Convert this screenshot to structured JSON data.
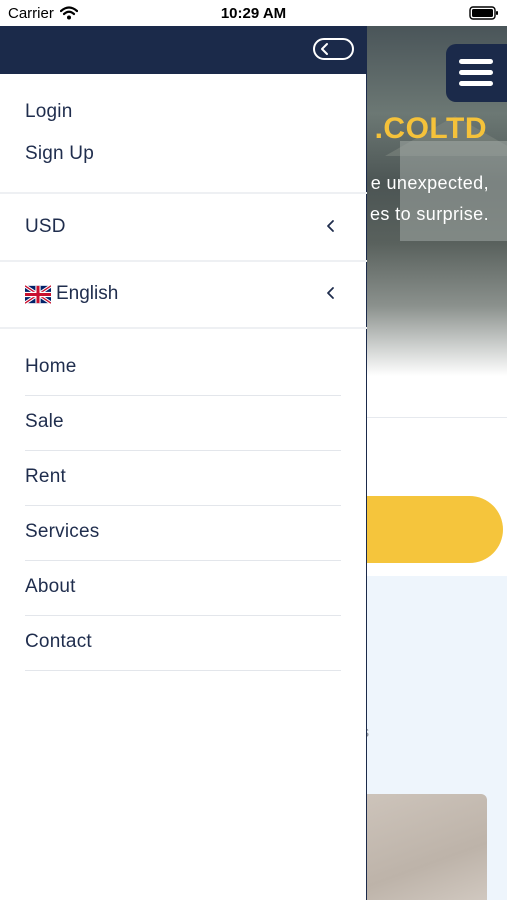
{
  "status_bar": {
    "carrier": "Carrier",
    "time": "10:29 AM"
  },
  "background": {
    "hero_title": ".COLTD",
    "hero_line1": "e unexpected,",
    "hero_line2": "es to surprise.",
    "properties_text": "erties",
    "colors": {
      "accent_yellow": "#f5c23a",
      "navy": "#1b2a4a",
      "light_blue": "#eef5fc"
    }
  },
  "drawer": {
    "auth": {
      "login": "Login",
      "signup": "Sign Up"
    },
    "currency": {
      "value": "USD"
    },
    "language": {
      "value": "English",
      "flag_icon": "uk-flag-icon"
    },
    "nav": [
      "Home",
      "Sale",
      "Rent",
      "Services",
      "About",
      "Contact"
    ]
  }
}
